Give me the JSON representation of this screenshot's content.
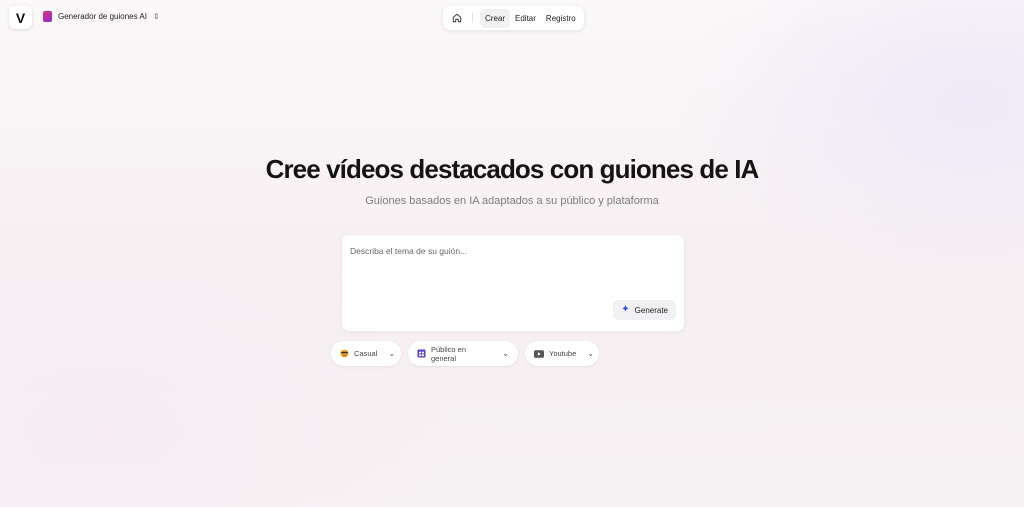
{
  "header": {
    "logo_letter": "V",
    "product_name": "Generador de guiones AI",
    "nav": {
      "tabs": [
        {
          "label": "Crear",
          "active": true
        },
        {
          "label": "Editar",
          "active": false
        },
        {
          "label": "Registro",
          "active": false
        }
      ]
    }
  },
  "hero": {
    "title": "Cree vídeos destacados con guiones de IA",
    "subtitle": "Guiones basados en IA adaptados a su público y plataforma"
  },
  "prompt": {
    "placeholder": "Describa el tema de su guión...",
    "value": "",
    "generate_label": "Generate"
  },
  "options": {
    "tone": {
      "label": "Casual",
      "icon": "face-icon"
    },
    "audience": {
      "label": "Público en general",
      "icon": "people-icon"
    },
    "platform": {
      "label": "Youtube",
      "icon": "youtube-icon"
    }
  },
  "colors": {
    "accent": "#2f4de0",
    "brand_gradient_start": "#e0347a",
    "brand_gradient_end": "#8b2bd1"
  }
}
